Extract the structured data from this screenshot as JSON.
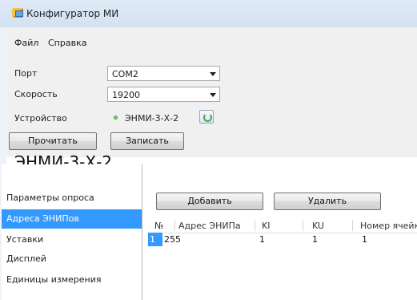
{
  "window": {
    "title": "Конфигуратор МИ"
  },
  "menu": {
    "file": "Файл",
    "help": "Справка"
  },
  "port": {
    "label": "Порт",
    "value": "COM2"
  },
  "speed": {
    "label": "Скорость",
    "value": "19200"
  },
  "device": {
    "label": "Устройство",
    "value": "ЭНМИ-3-Х-2",
    "status_color": "#7ccf7c"
  },
  "buttons": {
    "read": "Прочитать",
    "write": "Записать",
    "add": "Добавить",
    "delete": "Удалить"
  },
  "device_title": "ЭНМИ-3-Х-2",
  "sidebar": {
    "items": [
      {
        "label": "Параметры опроса"
      },
      {
        "label": "Адреса ЭНИПов"
      },
      {
        "label": "Уставки"
      },
      {
        "label": "Дисплей"
      },
      {
        "label": "Единицы измерения"
      }
    ],
    "selected_index": 1,
    "accent": "#3399ff"
  },
  "grid": {
    "columns": [
      "№",
      "Адрес ЭНИПа",
      "KI",
      "KU",
      "Номер ячейк"
    ],
    "rows": [
      [
        "1",
        "255",
        "1",
        "1",
        "1"
      ]
    ]
  }
}
